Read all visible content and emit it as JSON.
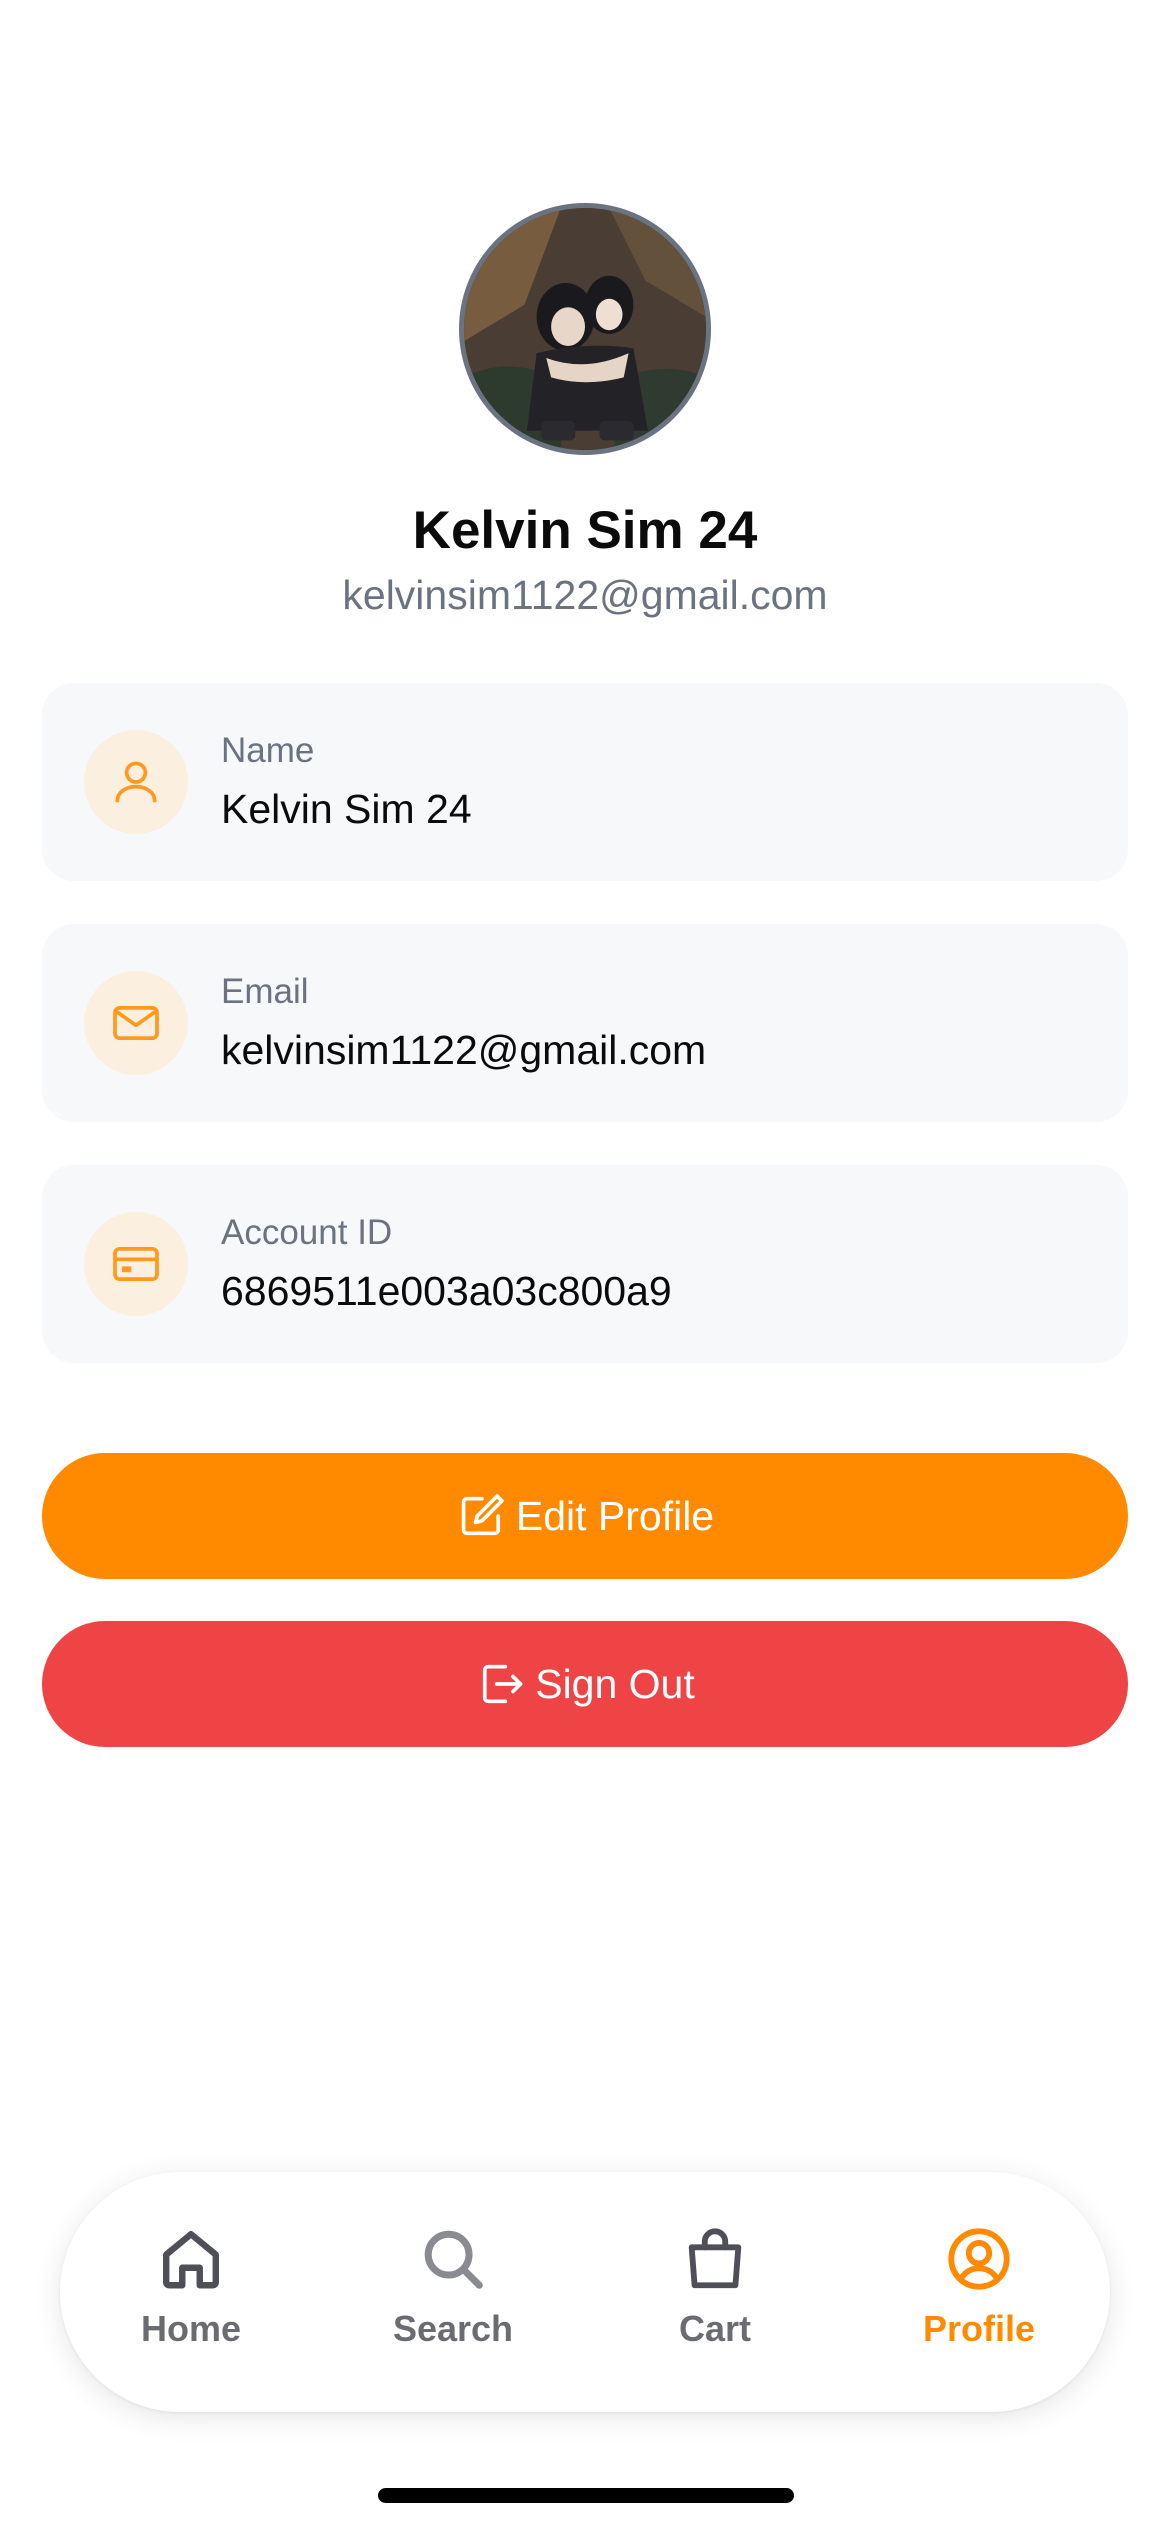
{
  "profile": {
    "display_name": "Kelvin Sim 24",
    "email": "kelvinsim1122@gmail.com"
  },
  "info": {
    "name": {
      "label": "Name",
      "value": "Kelvin Sim 24",
      "icon": "user-icon"
    },
    "email": {
      "label": "Email",
      "value": "kelvinsim1122@gmail.com",
      "icon": "mail-icon"
    },
    "account_id": {
      "label": "Account ID",
      "value": "6869511e003a03c800a9",
      "icon": "card-icon"
    }
  },
  "actions": {
    "edit_label": "Edit Profile",
    "signout_label": "Sign Out"
  },
  "tabs": [
    {
      "label": "Home",
      "icon": "home-icon",
      "active": false
    },
    {
      "label": "Search",
      "icon": "search-icon",
      "active": false
    },
    {
      "label": "Cart",
      "icon": "bag-icon",
      "active": false
    },
    {
      "label": "Profile",
      "icon": "profile-icon",
      "active": true
    }
  ],
  "colors": {
    "accent": "#ff8a00",
    "danger": "#ef4446",
    "muted_text": "#6b7280",
    "icon_bg": "#fbefe0",
    "card_bg": "#f7f8fa",
    "tab_inactive": "#6b6b72"
  }
}
